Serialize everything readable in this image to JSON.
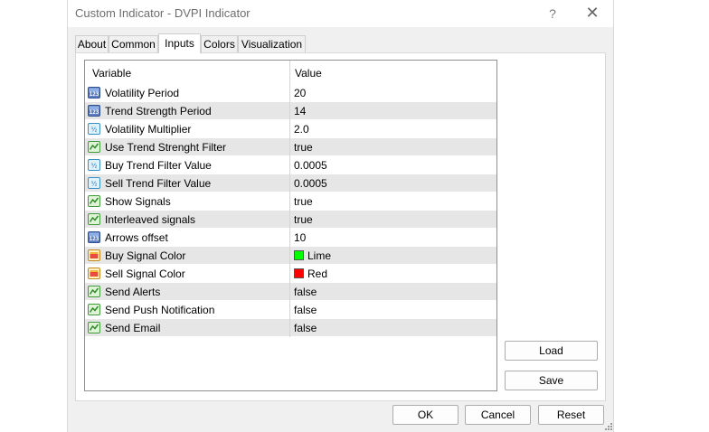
{
  "window": {
    "title": "Custom Indicator - DVPI Indicator",
    "help_glyph": "?",
    "close_glyph": "✕"
  },
  "tabs": [
    {
      "label": "About",
      "active": false
    },
    {
      "label": "Common",
      "active": false
    },
    {
      "label": "Inputs",
      "active": true
    },
    {
      "label": "Colors",
      "active": false
    },
    {
      "label": "Visualization",
      "active": false
    }
  ],
  "grid": {
    "col_variable": "Variable",
    "col_value": "Value",
    "rows": [
      {
        "icon": "int-icon",
        "name": "Volatility Period",
        "value": "20"
      },
      {
        "icon": "int-icon",
        "name": "Trend Strength Period",
        "value": "14"
      },
      {
        "icon": "double-icon",
        "name": "Volatility Multiplier",
        "value": "2.0"
      },
      {
        "icon": "bool-icon",
        "name": "Use Trend Strenght Filter",
        "value": "true"
      },
      {
        "icon": "double-icon",
        "name": "Buy Trend Filter Value",
        "value": "0.0005"
      },
      {
        "icon": "double-icon",
        "name": "Sell Trend Filter Value",
        "value": "0.0005"
      },
      {
        "icon": "bool-icon",
        "name": "Show Signals",
        "value": "true"
      },
      {
        "icon": "bool-icon",
        "name": "Interleaved signals",
        "value": "true"
      },
      {
        "icon": "int-icon",
        "name": "Arrows offset",
        "value": "10"
      },
      {
        "icon": "color-icon",
        "name": "Buy Signal Color",
        "value": "Lime",
        "swatch": "#00ff00"
      },
      {
        "icon": "color-icon",
        "name": "Sell Signal Color",
        "value": "Red",
        "swatch": "#ff0000"
      },
      {
        "icon": "bool-icon",
        "name": "Send Alerts",
        "value": "false"
      },
      {
        "icon": "bool-icon",
        "name": "Send Push Notification",
        "value": "false"
      },
      {
        "icon": "bool-icon",
        "name": "Send Email",
        "value": "false"
      }
    ]
  },
  "side_buttons": {
    "load": "Load",
    "save": "Save"
  },
  "footer": {
    "ok": "OK",
    "cancel": "Cancel",
    "reset": "Reset"
  },
  "colors": {
    "window_bg": "#f0f0f0",
    "row_alt": "#e6e6e6",
    "border": "#adadad"
  }
}
